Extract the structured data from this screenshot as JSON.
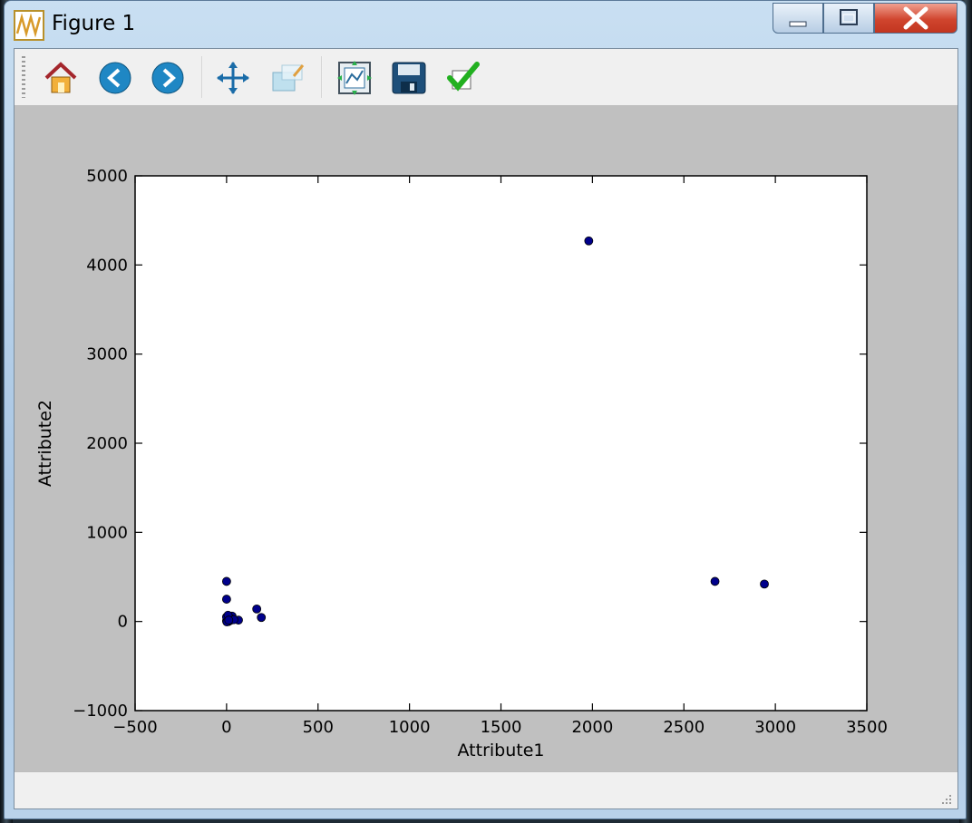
{
  "window": {
    "title": "Figure 1"
  },
  "toolbar": {
    "buttons": [
      {
        "name": "home-button",
        "icon": "home-icon"
      },
      {
        "name": "back-button",
        "icon": "back-arrow-icon"
      },
      {
        "name": "forward-button",
        "icon": "forward-arrow-icon"
      },
      {
        "name": "pan-button",
        "icon": "move-arrows-icon"
      },
      {
        "name": "zoom-button",
        "icon": "zoom-rect-icon"
      },
      {
        "name": "configure-subplots-button",
        "icon": "subplots-icon"
      },
      {
        "name": "save-button",
        "icon": "floppy-disk-icon"
      },
      {
        "name": "edit-axis-button",
        "icon": "checkmark-icon"
      }
    ]
  },
  "colors": {
    "marker": "#00008b",
    "axes_bg": "#ffffff",
    "figure_bg": "#c0c0c0"
  },
  "chart_data": {
    "type": "scatter",
    "xlabel": "Attribute1",
    "ylabel": "Attribute2",
    "xlim": [
      -500,
      3500
    ],
    "ylim": [
      -1000,
      5000
    ],
    "xticks": [
      "−500",
      "0",
      "500",
      "1000",
      "1500",
      "2000",
      "2500",
      "3000",
      "3500"
    ],
    "yticks": [
      "−1000",
      "0",
      "1000",
      "2000",
      "3000",
      "4000",
      "5000"
    ],
    "grid": false,
    "points": [
      {
        "x": 1980,
        "y": 4270
      },
      {
        "x": 2670,
        "y": 450
      },
      {
        "x": 2940,
        "y": 420
      },
      {
        "x": 0,
        "y": 450
      },
      {
        "x": 0,
        "y": 250
      },
      {
        "x": 165,
        "y": 140
      },
      {
        "x": 190,
        "y": 45
      },
      {
        "x": 65,
        "y": 15
      },
      {
        "x": 30,
        "y": 60
      },
      {
        "x": 15,
        "y": 40
      },
      {
        "x": 5,
        "y": 20
      },
      {
        "x": 0,
        "y": 5
      },
      {
        "x": 10,
        "y": 0
      },
      {
        "x": 20,
        "y": 10
      },
      {
        "x": 25,
        "y": 30
      },
      {
        "x": 40,
        "y": 20
      },
      {
        "x": 0,
        "y": 50
      },
      {
        "x": 8,
        "y": 70
      },
      {
        "x": 2,
        "y": -5
      },
      {
        "x": 12,
        "y": 15
      }
    ]
  }
}
